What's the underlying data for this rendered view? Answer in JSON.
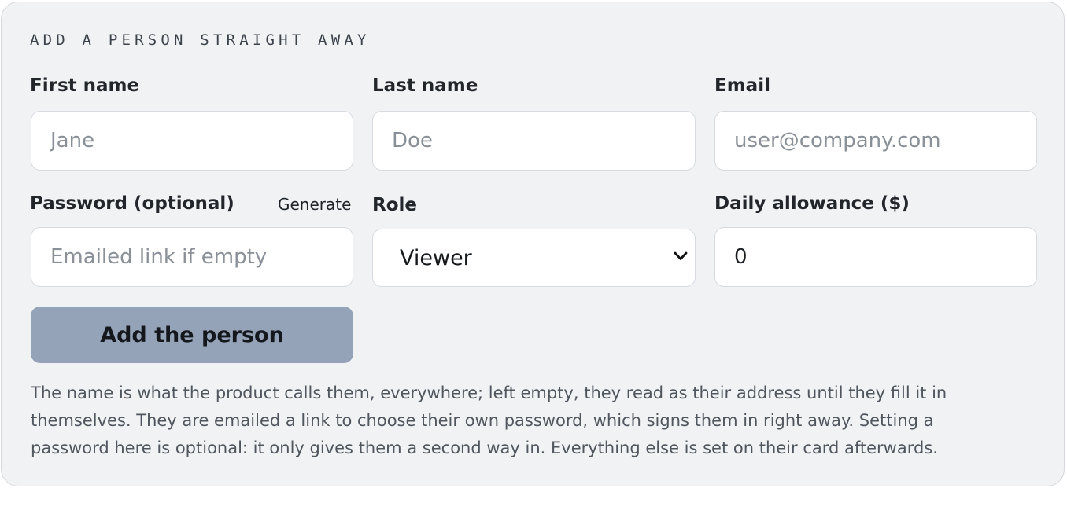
{
  "section": {
    "eyebrow": "ADD A PERSON STRAIGHT AWAY"
  },
  "form": {
    "first_name": {
      "label": "First name",
      "placeholder": "Jane",
      "value": ""
    },
    "last_name": {
      "label": "Last name",
      "placeholder": "Doe",
      "value": ""
    },
    "email": {
      "label": "Email",
      "placeholder": "user@company.com",
      "value": ""
    },
    "password": {
      "label": "Password (optional)",
      "generate_label": "Generate",
      "placeholder": "Emailed link if empty",
      "value": ""
    },
    "role": {
      "label": "Role",
      "selected": "Viewer"
    },
    "allowance": {
      "label": "Daily allowance ($)",
      "value": "0"
    },
    "submit_label": "Add the person",
    "help_text": "The name is what the product calls them, everywhere; left empty, they read as their address until they fill it in themselves. They are emailed a link to choose their own password, which signs them in right away. Setting a password here is optional: it only gives them a second way in. Everything else is set on their card afterwards."
  },
  "icons": {
    "role_dropdown": "chevron-down-icon"
  },
  "colors": {
    "card_background": "#f0f2f4",
    "submit_background": "#94a3b8",
    "input_border": "#d7dbe0"
  }
}
